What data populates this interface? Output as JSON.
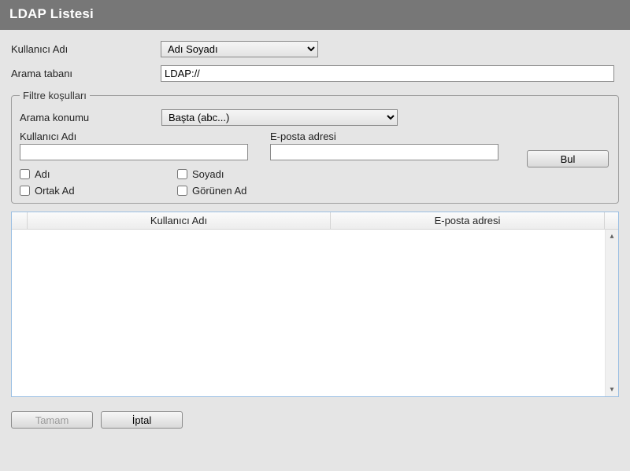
{
  "title": "LDAP Listesi",
  "labels": {
    "username": "Kullanıcı Adı",
    "searchbase": "Arama tabanı",
    "filter_legend": "Filtre koşulları",
    "search_location": "Arama konumu",
    "email": "E-posta adresi",
    "ad": "Adı",
    "soyad": "Soyadı",
    "ortak_ad": "Ortak Ad",
    "gorunen_ad": "Görünen Ad"
  },
  "values": {
    "username_select": "Adı Soyadı",
    "searchbase_input": "LDAP://",
    "search_location_select": "Başta (abc...)",
    "filter_username": "",
    "filter_email": ""
  },
  "checks": {
    "ad": false,
    "soyad": false,
    "ortak_ad": false,
    "gorunen_ad": false
  },
  "buttons": {
    "find": "Bul",
    "ok": "Tamam",
    "cancel": "İptal"
  },
  "table": {
    "col1": "Kullanıcı Adı",
    "col2": "E-posta adresi"
  }
}
